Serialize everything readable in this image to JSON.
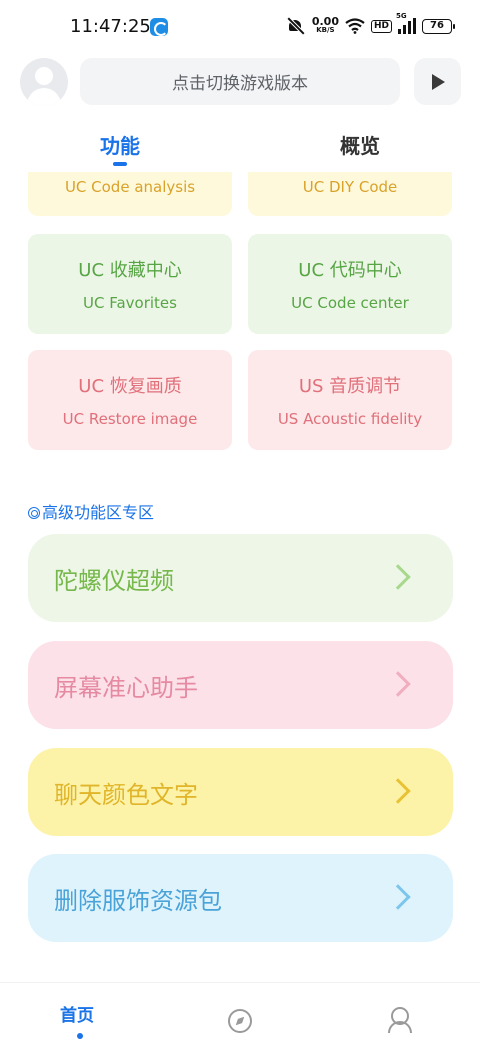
{
  "status_bar": {
    "time": "11:47:25",
    "net_speed_value": "0.00",
    "net_speed_unit": "KB/S",
    "hd_label": "HD",
    "network_type": "5G",
    "battery_level": "76"
  },
  "header": {
    "search_placeholder": "点击切换游戏版本"
  },
  "tabs": [
    {
      "label": "功能",
      "active": true
    },
    {
      "label": "概览",
      "active": false
    }
  ],
  "feature_cards": [
    {
      "zh": "",
      "en": "UC Code analysis",
      "color": "yellow"
    },
    {
      "zh": "",
      "en": "UC DIY Code",
      "color": "yellow"
    },
    {
      "zh": "UC 收藏中心",
      "en": "UC Favorites",
      "color": "green"
    },
    {
      "zh": "UC 代码中心",
      "en": "UC Code center",
      "color": "green"
    },
    {
      "zh": "UC 恢复画质",
      "en": "UC Restore image",
      "color": "pink"
    },
    {
      "zh": "US 音质调节",
      "en": "US Acoustic fidelity",
      "color": "pink"
    }
  ],
  "advanced_section": {
    "title": "高级功能区专区",
    "items": [
      {
        "label": "陀螺仪超频",
        "color": "#76b84c"
      },
      {
        "label": "屏幕准心助手",
        "color": "#e68aa3"
      },
      {
        "label": "聊天颜色文字",
        "color": "#e0b52a"
      },
      {
        "label": "删除服饰资源包",
        "color": "#4aa3d8"
      }
    ]
  },
  "bottom_nav": {
    "home_label": "首页",
    "icons": [
      "compass-icon",
      "profile-icon"
    ]
  },
  "accent_color": "#1a73e8"
}
